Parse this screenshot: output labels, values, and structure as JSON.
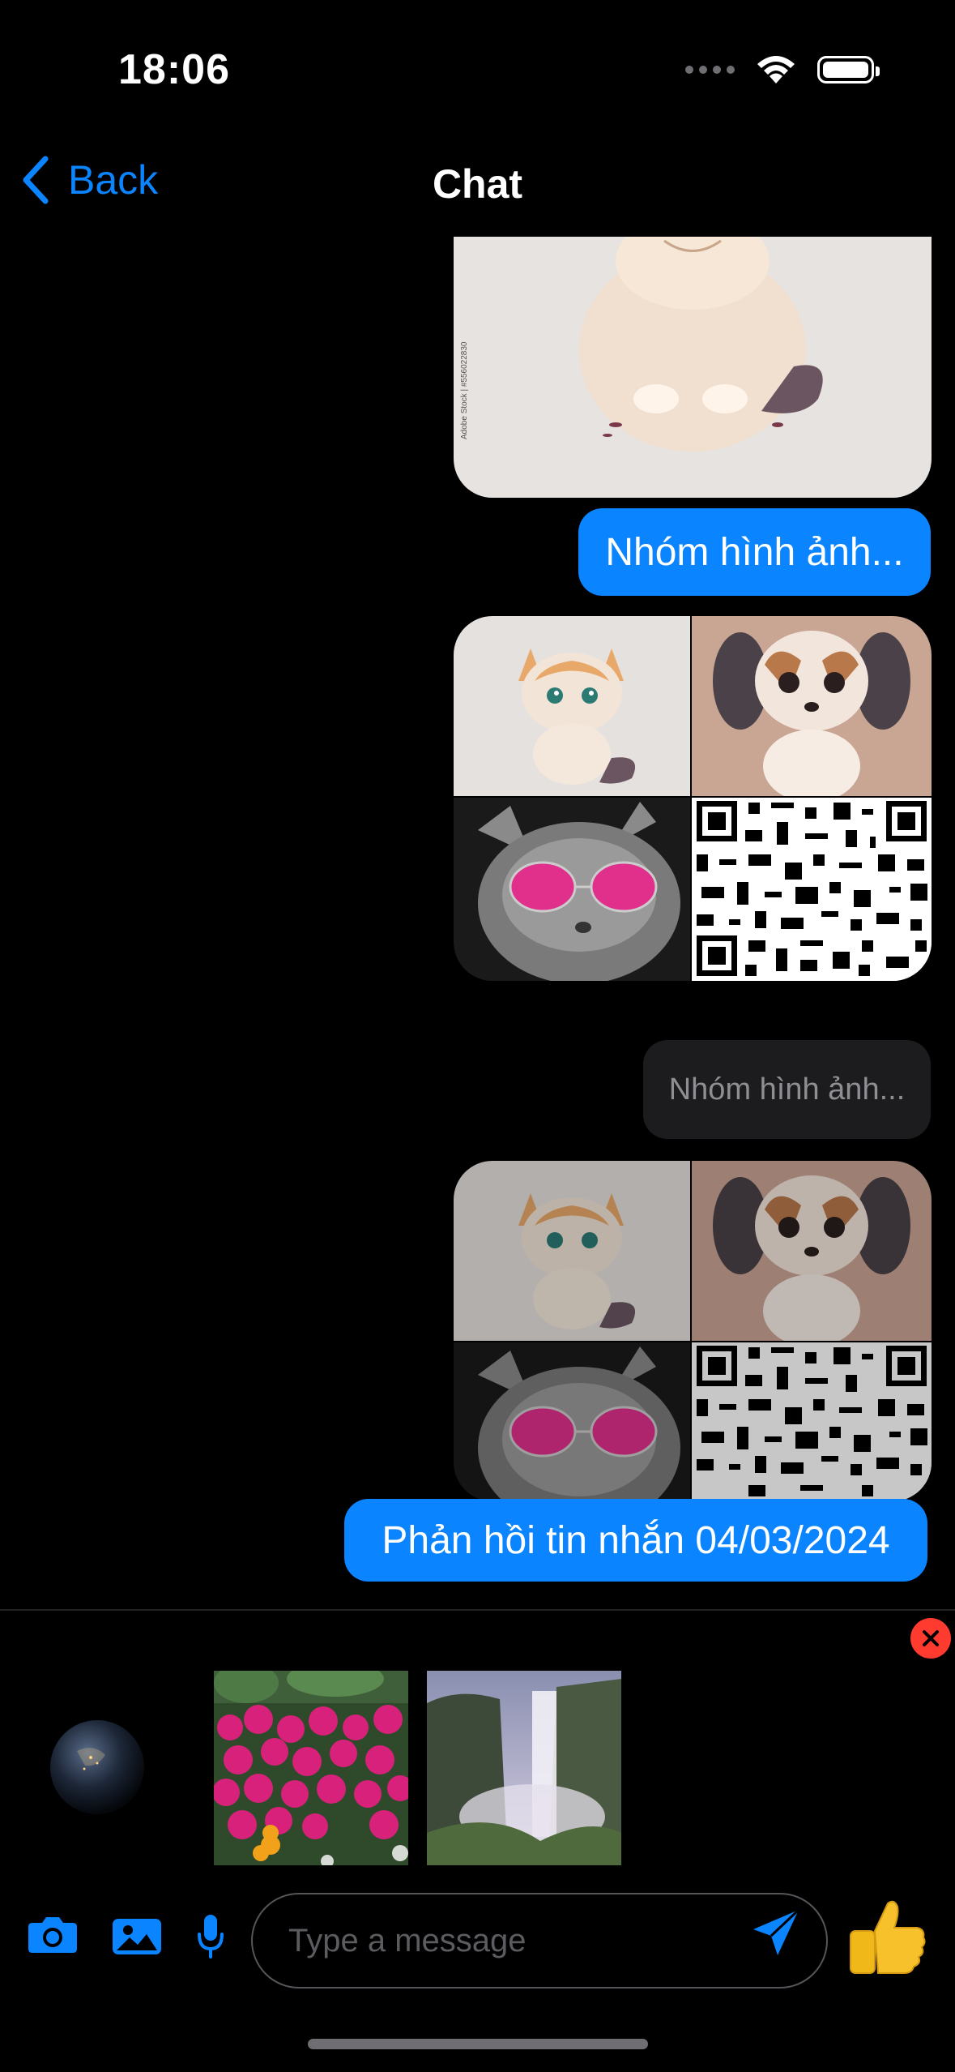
{
  "status_bar": {
    "time": "18:06"
  },
  "nav": {
    "back_label": "Back",
    "title": "Chat"
  },
  "messages": [
    {
      "type": "image",
      "subject": "cat-illustration"
    },
    {
      "type": "text",
      "text": "Nhóm hình ảnh..."
    },
    {
      "type": "image-grid",
      "subjects": [
        "cat-illustration",
        "puppy-illustration",
        "cat-with-pink-sunglasses",
        "qr-code"
      ]
    },
    {
      "type": "text-pending",
      "text": "Nhóm hình ảnh..."
    },
    {
      "type": "image-grid",
      "subjects": [
        "cat-illustration",
        "puppy-illustration",
        "cat-with-pink-sunglasses",
        "qr-code"
      ]
    },
    {
      "type": "text",
      "text": "Phản hồi tin nhắn 04/03/2024"
    }
  ],
  "attachments": [
    {
      "subject": "earth-at-night"
    },
    {
      "subject": "pink-flowers"
    },
    {
      "subject": "waterfall"
    }
  ],
  "composer": {
    "placeholder": "Type a message",
    "icons": [
      "camera-icon",
      "photo-icon",
      "microphone-icon",
      "send-icon",
      "thumbs-up-icon"
    ]
  },
  "colors": {
    "accent": "#0a84ff",
    "background": "#000000",
    "close": "#ff3b30"
  }
}
